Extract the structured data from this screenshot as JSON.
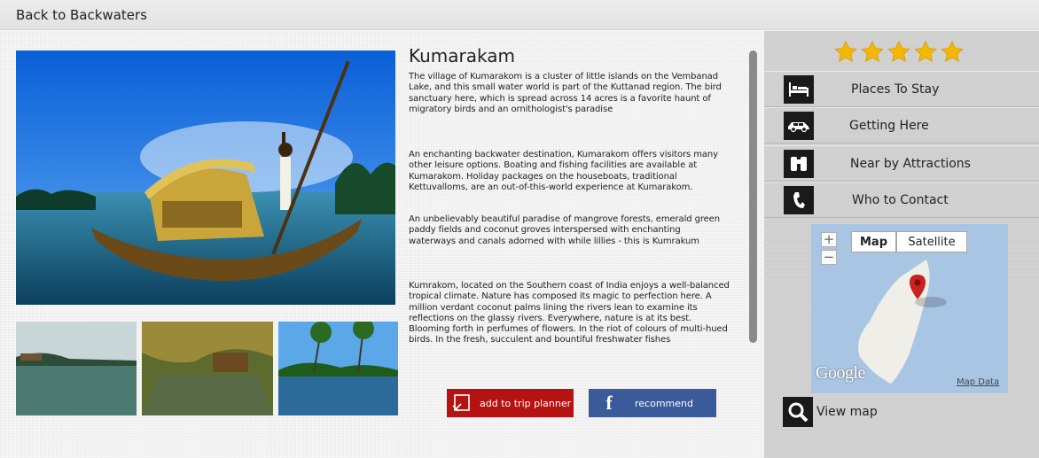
{
  "header": {
    "back_label": "Back to Backwaters"
  },
  "destination": {
    "title": "Kumarakam",
    "paragraphs": [
      "The village of Kumarakom is a cluster of little islands on the Vembanad Lake, and this small water world is part of the Kuttanad region. The bird sanctuary here, which is spread across 14 acres is a favorite haunt of migratory birds and an ornithologist's paradise",
      "An enchanting backwater destination, Kumarakom offers visitors many other leisure options. Boating and fishing facilities are available at Kumarakom. Holiday packages on the houseboats, traditional Kettuvalloms, are an out-of-this-world experience at Kumarakom.",
      "An unbelievably beautiful paradise of mangrove forests, emerald green paddy fields and coconut groves interspersed with enchanting waterways and canals adorned with while lillies - this is Kumrakum",
      "Kumrakom, located on the Southern coast of India enjoys a well-balanced tropical climate. Nature has composed its magic to perfection here. A million verdant coconut palms lining the rivers lean to examine its reflections on the glassy rivers. Everywhere, nature is at its best. Blooming forth in perfumes of flowers. In the riot of colours of multi-hued birds. In the fresh, succulent and bountiful freshwater fishes"
    ]
  },
  "actions": {
    "trip_label": "add to trip planner",
    "recommend_label": "recommend",
    "facebook_glyph": "f"
  },
  "sidebar": {
    "rating": 5,
    "menu": [
      {
        "label": "Places To Stay",
        "icon": "bed-icon"
      },
      {
        "label": "Getting Here",
        "icon": "car-icon"
      },
      {
        "label": "Near by Attractions",
        "icon": "binoculars-icon"
      },
      {
        "label": "Who to Contact",
        "icon": "phone-icon"
      }
    ],
    "map": {
      "type_map": "Map",
      "type_satellite": "Satellite",
      "zoom_in": "+",
      "zoom_out": "−",
      "logo": "Google",
      "data_link": "Map Data"
    },
    "view_map_label": "View map"
  },
  "colors": {
    "trip_button": "#b51212",
    "recommend_button": "#3a5a9a",
    "star": "#f5b800"
  }
}
